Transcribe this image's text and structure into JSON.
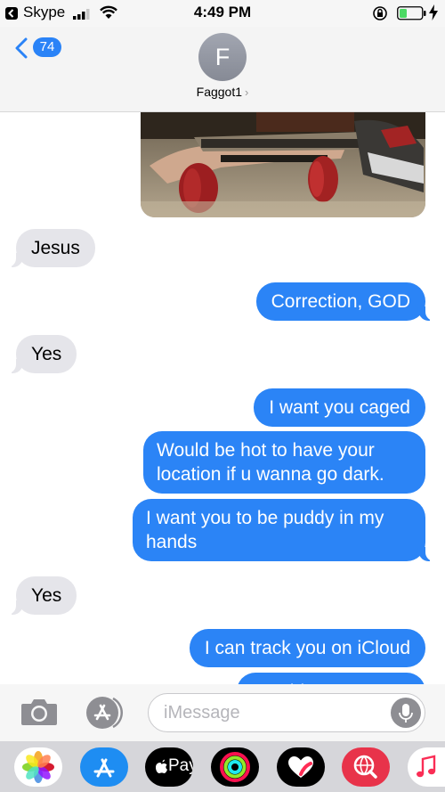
{
  "status_bar": {
    "app_name": "Skype",
    "time": "4:49 PM"
  },
  "header": {
    "back_count": "74",
    "avatar_initial": "F",
    "contact_name": "Faggot1"
  },
  "messages": [
    {
      "type": "photo",
      "direction": "outgoing",
      "description_icon": "photo-attachment"
    },
    {
      "direction": "incoming",
      "text": "Jesus"
    },
    {
      "direction": "outgoing",
      "text": "Correction, GOD"
    },
    {
      "direction": "incoming",
      "text": "Yes"
    },
    {
      "direction": "outgoing",
      "text": "I want you caged"
    },
    {
      "direction": "outgoing",
      "text": "Would be hot to have your location if u wanna go dark."
    },
    {
      "direction": "outgoing",
      "text": "I want you to be puddy in my hands"
    },
    {
      "direction": "incoming",
      "text": "Yes"
    },
    {
      "direction": "outgoing",
      "text": "I can track you on iCloud"
    },
    {
      "direction": "outgoing",
      "text": "Would"
    }
  ],
  "input": {
    "placeholder": "iMessage"
  },
  "app_drawer": {
    "apple_pay_label": "Pay",
    "apps": [
      "photos-icon",
      "app-store-icon",
      "apple-pay-icon",
      "activity-icon",
      "digital-touch-icon",
      "web-search-icon",
      "music-icon"
    ]
  },
  "colors": {
    "outgoing_bubble": "#2b84f6",
    "incoming_bubble": "#e5e5ea",
    "badge": "#2a83f7"
  }
}
